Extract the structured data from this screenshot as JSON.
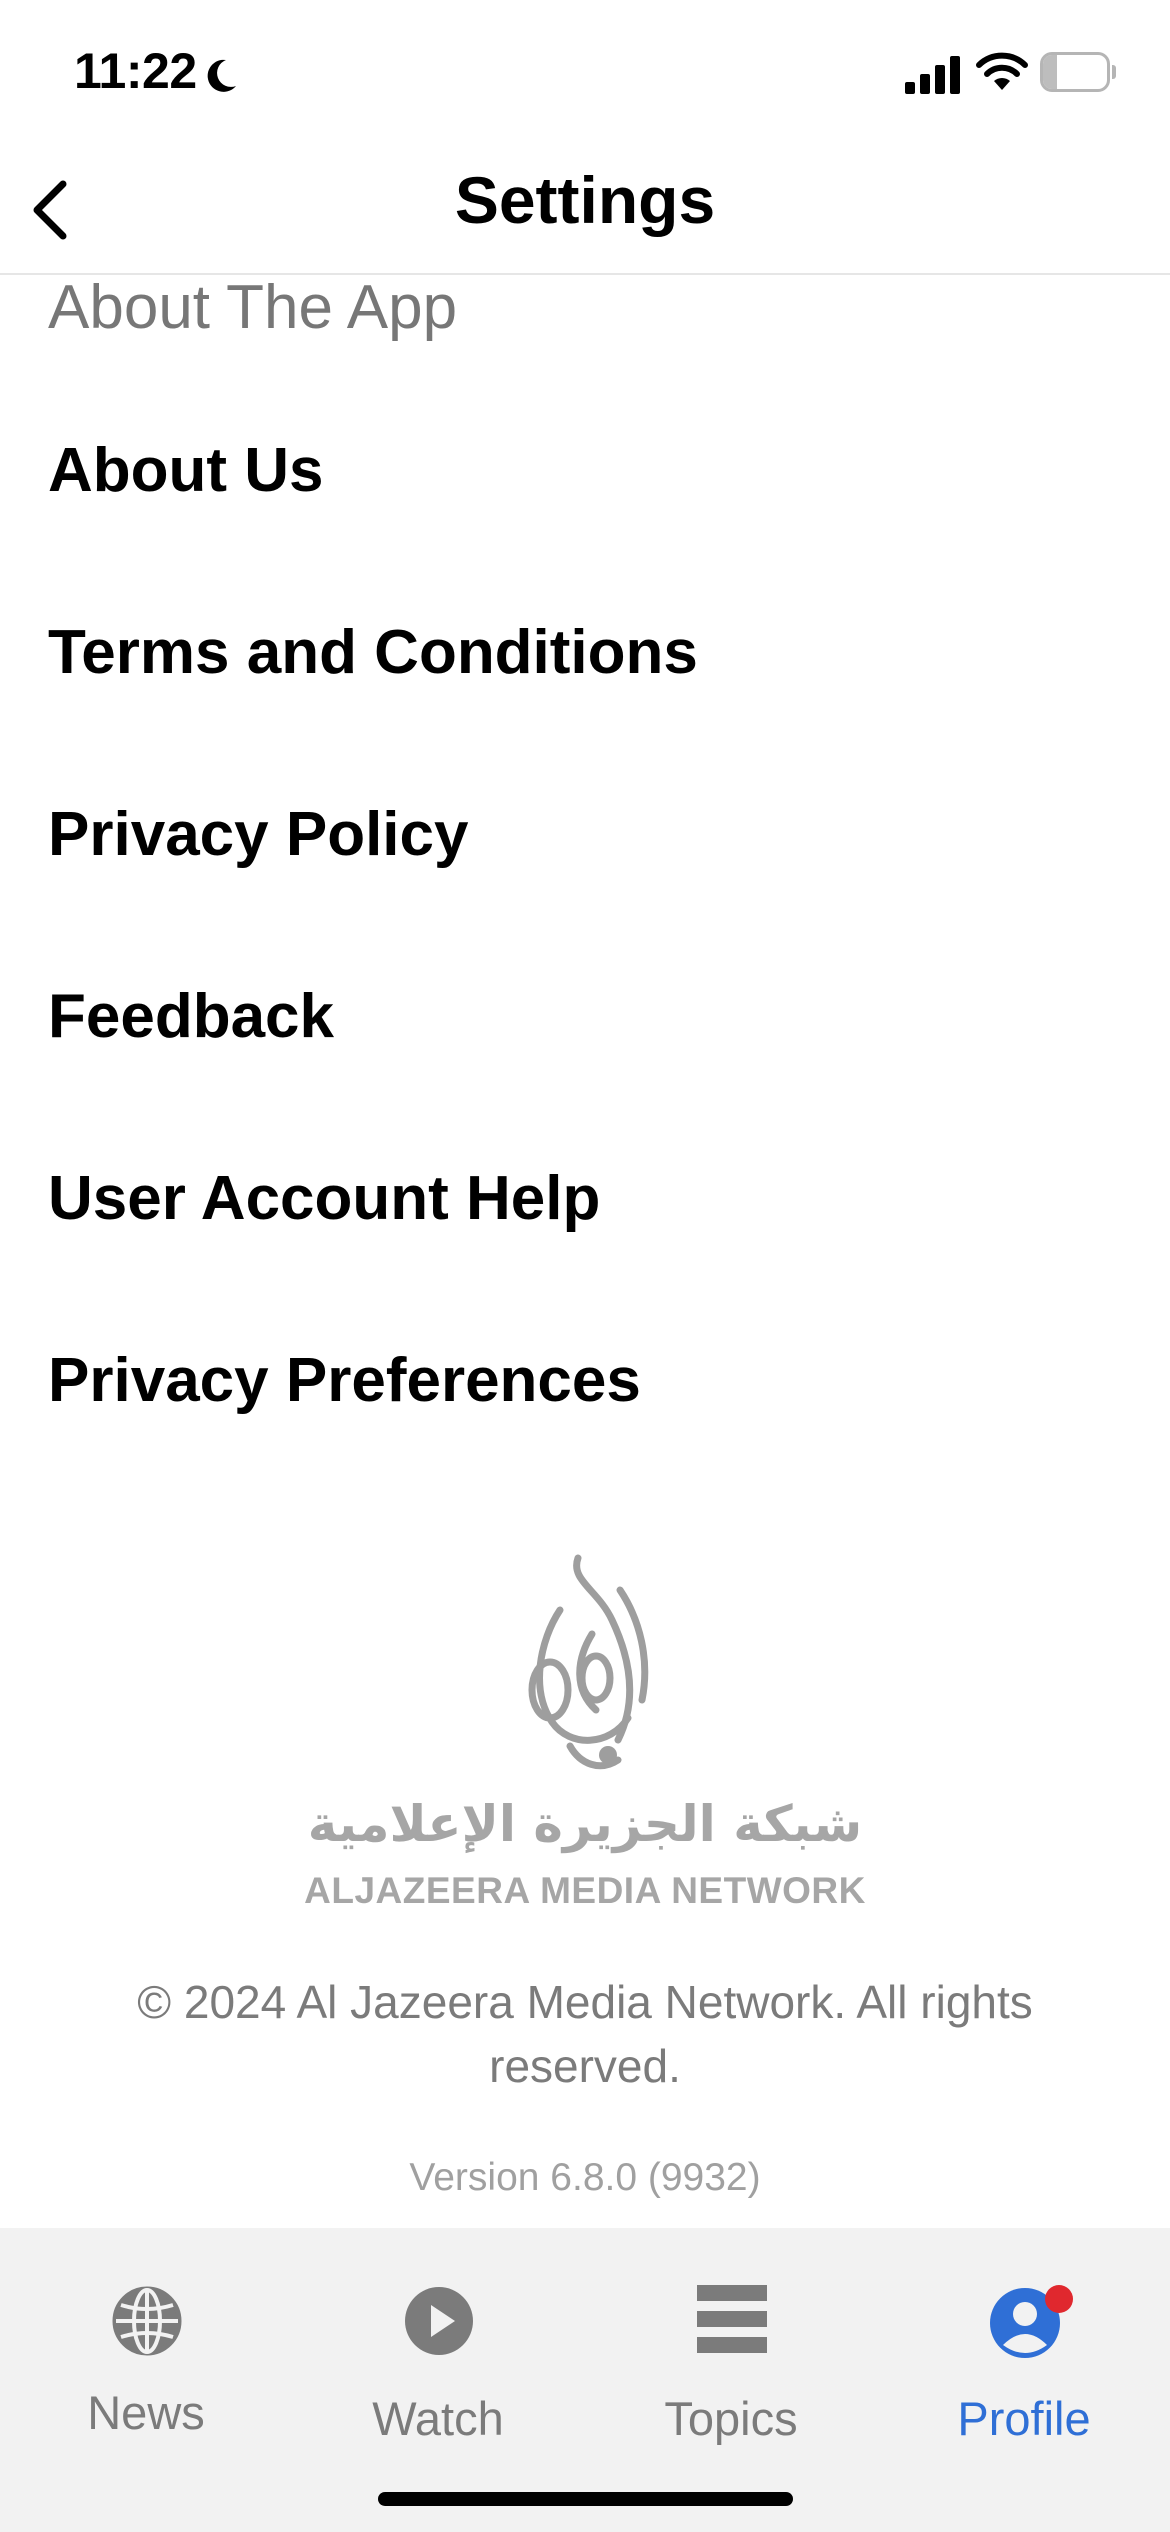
{
  "status_bar": {
    "time": "11:22",
    "battery_text": "22",
    "battery_level": 0.22,
    "icons": [
      "moon-icon",
      "cellular-signal-icon",
      "wifi-icon",
      "battery-icon"
    ]
  },
  "nav": {
    "title": "Settings",
    "back_icon": "chevron-left-icon"
  },
  "section": {
    "header": "About The App",
    "items": [
      {
        "label": "About Us"
      },
      {
        "label": "Terms and Conditions"
      },
      {
        "label": "Privacy Policy"
      },
      {
        "label": "Feedback"
      },
      {
        "label": "User Account Help"
      },
      {
        "label": "Privacy Preferences"
      }
    ]
  },
  "footer": {
    "logo_arabic": "شبكة الجزيرة الإعلامية",
    "logo_latin": "ALJAZEERA MEDIA NETWORK",
    "copyright": "© 2024 Al Jazeera Media Network. All rights reserved.",
    "version": "Version 6.8.0 (9932)"
  },
  "tab_bar": {
    "tabs": [
      {
        "label": "News",
        "icon": "globe-icon",
        "active": false
      },
      {
        "label": "Watch",
        "icon": "play-circle-icon",
        "active": false
      },
      {
        "label": "Topics",
        "icon": "topics-list-icon",
        "active": false
      },
      {
        "label": "Profile",
        "icon": "profile-icon",
        "active": true
      }
    ]
  },
  "colors": {
    "accent": "#2f6fd6",
    "notification_dot": "#e0282e",
    "inactive": "#7b7b7b",
    "tab_bar_bg": "#f2f2f2"
  }
}
